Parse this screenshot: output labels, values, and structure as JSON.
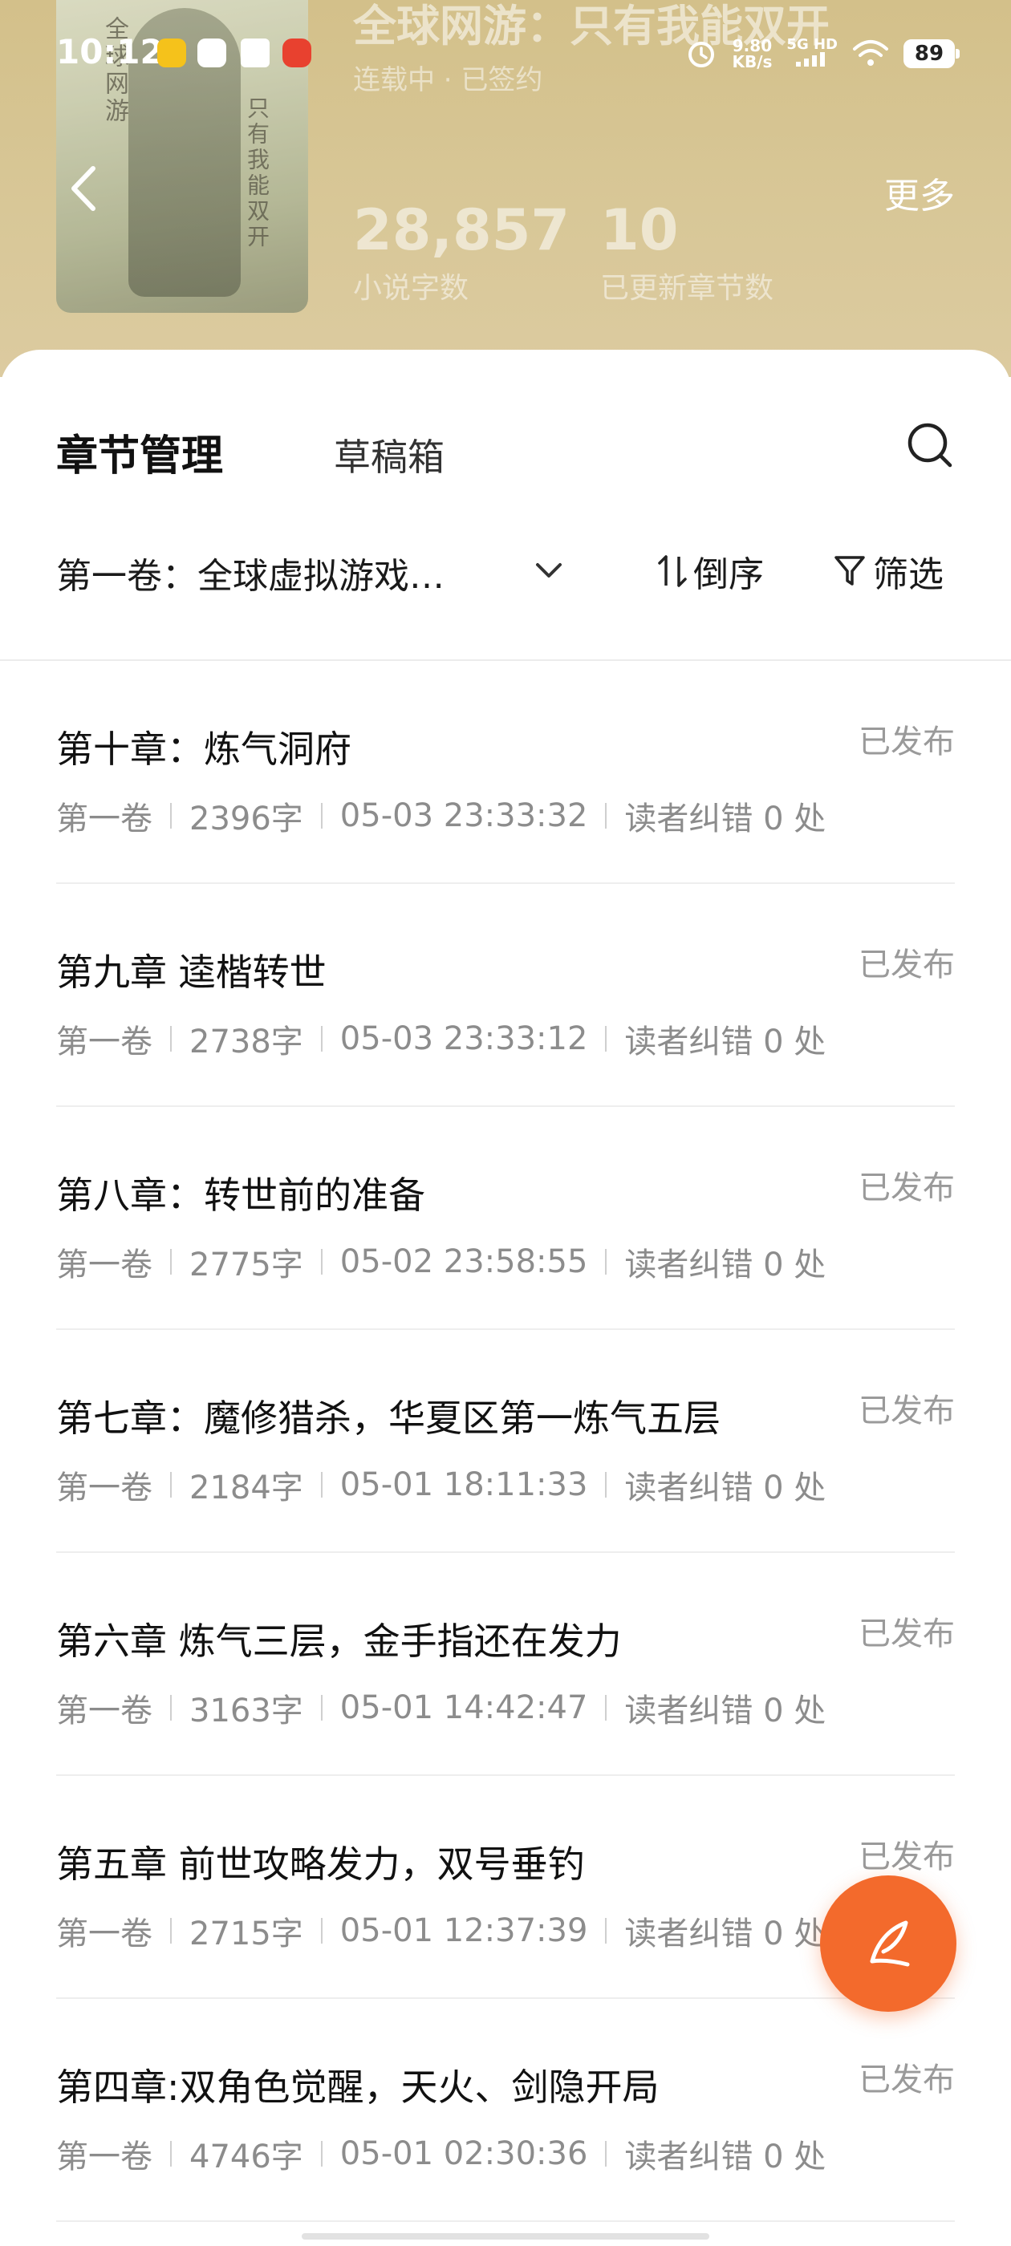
{
  "status_bar": {
    "time": "10:12",
    "net_speed": "9.80",
    "net_speed_unit": "KB/s",
    "network_type": "5G HD",
    "battery": "89"
  },
  "book": {
    "title": "全球网游：只有我能双开",
    "status": "连载中 · 已签约",
    "word_count": "28,857",
    "word_count_label": "小说字数",
    "chapter_count": "10",
    "chapter_count_label": "已更新章节数",
    "cover_text_1": "全球网游",
    "cover_text_2": "只有我能双开"
  },
  "header": {
    "more_label": "更多"
  },
  "tabs": [
    {
      "label": "章节管理",
      "active": true
    },
    {
      "label": "草稿箱",
      "active": false
    }
  ],
  "filter": {
    "volume_label": "第一卷：全球虚拟游戏…",
    "sort_label": "倒序",
    "filter_label": "筛选"
  },
  "chapters": [
    {
      "title": "第十章：炼气洞府",
      "status": "已发布",
      "volume": "第一卷",
      "words": "2396字",
      "time": "05-03 23:33:32",
      "corrections": "读者纠错 0 处"
    },
    {
      "title": "第九章 逵楷转世",
      "status": "已发布",
      "volume": "第一卷",
      "words": "2738字",
      "time": "05-03 23:33:12",
      "corrections": "读者纠错 0 处"
    },
    {
      "title": "第八章：转世前的准备",
      "status": "已发布",
      "volume": "第一卷",
      "words": "2775字",
      "time": "05-02 23:58:55",
      "corrections": "读者纠错 0 处"
    },
    {
      "title": "第七章：魔修猎杀，华夏区第一炼气五层",
      "status": "已发布",
      "volume": "第一卷",
      "words": "2184字",
      "time": "05-01 18:11:33",
      "corrections": "读者纠错 0 处"
    },
    {
      "title": "第六章 炼气三层，金手指还在发力",
      "status": "已发布",
      "volume": "第一卷",
      "words": "3163字",
      "time": "05-01 14:42:47",
      "corrections": "读者纠错 0 处"
    },
    {
      "title": "第五章 前世攻略发力，双号垂钓",
      "status": "已发布",
      "volume": "第一卷",
      "words": "2715字",
      "time": "05-01 12:37:39",
      "corrections": "读者纠错 0 处"
    },
    {
      "title": "第四章:双角色觉醒，天火、剑隐开局",
      "status": "已发布",
      "volume": "第一卷",
      "words": "4746字",
      "time": "05-01 02:30:36",
      "corrections": "读者纠错 0 处"
    }
  ],
  "colors": {
    "header_bg": "#d6c592",
    "accent": "#f36a2c",
    "status_gray": "#9a9a9a"
  },
  "icons": {
    "back": "back-arrow-icon",
    "search": "search-icon",
    "dropdown": "chevron-down-icon",
    "sort": "sort-icon",
    "filter": "filter-funnel-icon",
    "write": "quill-pen-icon"
  }
}
